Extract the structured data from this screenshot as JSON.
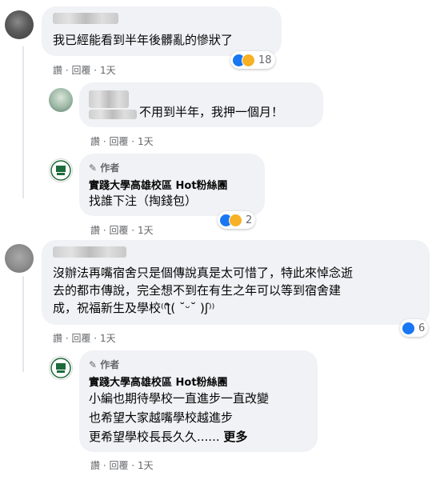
{
  "comments": [
    {
      "text": "我已經能看到半年後髒亂的慘狀了",
      "actions": {
        "like": "讚",
        "reply": "回覆",
        "time": "1天"
      },
      "reactions": {
        "count": "18",
        "icons": [
          "like-icon",
          "haha-icon"
        ]
      }
    },
    {
      "text": "不用到半年，我押一個月！",
      "actions": {
        "like": "讚",
        "reply": "回覆",
        "time": "1天"
      }
    },
    {
      "author_badge": "作者",
      "page_name": "實踐大學高雄校區 Hot粉絲團",
      "text": "找誰下注（掏錢包）",
      "actions": {
        "like": "讚",
        "reply": "回覆",
        "time": "1天"
      },
      "reactions": {
        "count": "2",
        "icons": [
          "like-icon",
          "care-icon"
        ]
      }
    },
    {
      "lines": [
        "沒辦法再嘴宿舍只是個傳說真是太可惜了，特此來悼念逝",
        "去的都市傳說，完全想不到在有生之年可以等到宿舍建",
        "成，祝福新生及學校⁽⁽ƪ( ˘ᵕ˘ )ʃ⁾⁾"
      ],
      "actions": {
        "like": "讚",
        "reply": "回覆",
        "time": "1天"
      },
      "reactions": {
        "count": "6",
        "icons": [
          "like-icon"
        ]
      }
    },
    {
      "author_badge": "作者",
      "page_name": "實踐大學高雄校區 Hot粉絲團",
      "lines": [
        "小編也期待學校一直進步一直改變",
        "也希望大家越嘴學校越進步",
        "更希望學校長長久久......"
      ],
      "more": "更多",
      "actions": {
        "like": "讚",
        "reply": "回覆",
        "time": "1天"
      }
    }
  ],
  "colors": {
    "bubble": "#f0f2f5",
    "meta": "#65676b",
    "like": "#1877f2",
    "emoji": "#f7b125"
  }
}
